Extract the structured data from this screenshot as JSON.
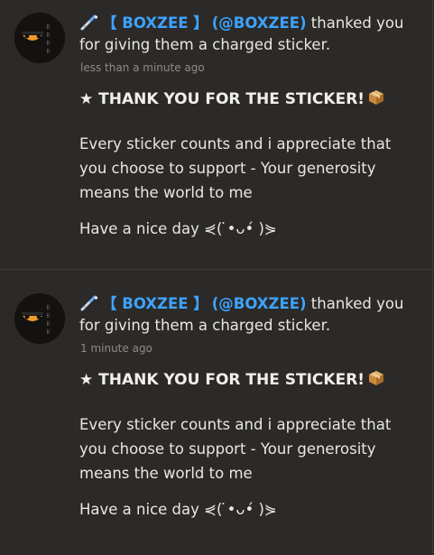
{
  "notifications": [
    {
      "user_name": "【 BOXZEE 】",
      "user_handle": "(@BOXZEE)",
      "action_text": " thanked you for giving them a charged sticker.",
      "time": "less than a minute ago",
      "title": "★ THANK YOU FOR THE STICKER!",
      "body": "Every sticker counts and i appreciate that you choose to support - Your generosity means the world to me",
      "signoff": "Have a nice day ⋞( ̇•ᴗ•́ )⋟"
    },
    {
      "user_name": "【 BOXZEE 】",
      "user_handle": "(@BOXZEE)",
      "action_text": " thanked you for giving them a charged sticker.",
      "time": "1 minute ago",
      "title": "★ THANK YOU FOR THE STICKER!",
      "body": "Every sticker counts and i appreciate that you choose to support - Your generosity means the world to me",
      "signoff": "Have a nice day ⋞( ̇•ᴗ•́ )⋟"
    }
  ],
  "colors": {
    "background": "#2b2a28",
    "username_accent": "#3ea3ff",
    "timestamp": "#8f8c86"
  },
  "icons": {
    "sticker_badge": "wand-icon",
    "title_emoji": "package-box-icon"
  }
}
